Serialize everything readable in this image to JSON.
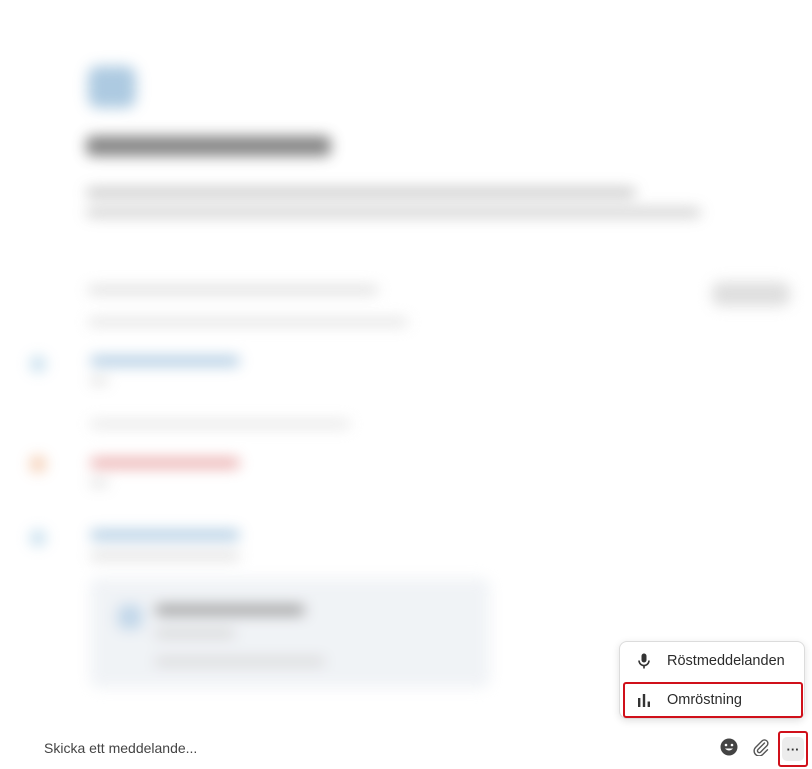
{
  "menu": {
    "items": [
      {
        "label": "Röstmeddelanden",
        "icon": "microphone-icon"
      },
      {
        "label": "Omröstning",
        "icon": "poll-icon"
      }
    ]
  },
  "composer": {
    "placeholder": "Skicka ett meddelande...",
    "more_label": "···"
  },
  "colors": {
    "highlight": "#d0101a",
    "icon_dark": "#333333"
  }
}
